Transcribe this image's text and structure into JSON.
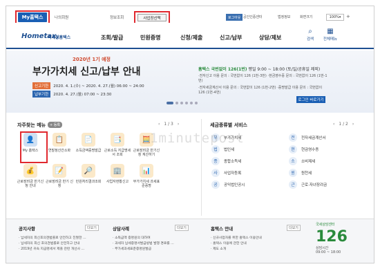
{
  "topbar": {
    "my_tab": "My홈택스",
    "my_info": "나의회원",
    "sep_text": "정보조회",
    "business_select": "사업장선택",
    "logout": "로그아웃",
    "cert_center": "공인인증센터",
    "basic_info": "법정정보",
    "screen_size": "화면크기",
    "zoom": "100%"
  },
  "nav": {
    "logo": "Hometax,",
    "logo_sub": "국세청홈택스",
    "items": [
      "조회/발급",
      "민원증명",
      "신청/제출",
      "신고/납부",
      "상담/제보"
    ],
    "search": "검색",
    "all_menu": "전체메뉴"
  },
  "banner": {
    "subtitle": "2020년 1기 예정",
    "title": "부가가치세 신고/납부 안내",
    "rows": [
      {
        "tag": "신고기한",
        "text": "2020. 4. 1.(수) ~ 2020. 4. 27.(월) 06:00 ~ 24:00"
      },
      {
        "tag": "납부기한",
        "text": "2020. 4. 27.(월) 07:00 ~ 23:30"
      }
    ],
    "right_head": "홈택스 국번없이 126(1번)",
    "right_hours": "평일 9:00 ~ 18:00 (토/일/공휴일 제외)",
    "right_lines": [
      "·전자신고 이용 문의 : 국번없이 126 (1번-3번) ·현금영수증 문의 : 국번없이 126 (1번-1번)",
      "·전자세금계산서 이용 문의 : 국번없이 126 (1번-2번) ·증명발급 이용 문의 : 국번없이 126 (1번-4번)"
    ],
    "button": "로그인 바로가기"
  },
  "favorites": {
    "title": "자주찾는 메뉴",
    "add": "+ 등록",
    "page": "1 / 3",
    "items": [
      {
        "label": "My 홈택스",
        "icon": "user-icon",
        "glyph": "👤",
        "blue": true
      },
      {
        "label": "연말정산간소화",
        "icon": "document-icon",
        "glyph": "📋",
        "blue": false
      },
      {
        "label": "소득금액증명발급",
        "icon": "certificate-icon",
        "glyph": "📄",
        "blue": false
      },
      {
        "label": "근로소득 지급명세서 조회",
        "icon": "list-icon",
        "glyph": "📑",
        "blue": false
      },
      {
        "label": "근로장려금 반기신청 계산하기",
        "icon": "calculator-icon",
        "glyph": "🧮",
        "blue": false
      },
      {
        "label": "",
        "icon": "",
        "glyph": "",
        "blue": false
      },
      {
        "label": "근로장려금 반기신청 안내",
        "icon": "money-icon",
        "glyph": "💰",
        "blue": false
      },
      {
        "label": "근로장려금 반기 신청",
        "icon": "apply-icon",
        "glyph": "📝",
        "blue": false
      },
      {
        "label": "민원처리결과조회",
        "icon": "search-doc-icon",
        "glyph": "🔎",
        "blue": false
      },
      {
        "label": "사업자현황신고",
        "icon": "building-icon",
        "glyph": "🏢",
        "blue": false
      },
      {
        "label": "부가가치세 과세표준증명",
        "icon": "report-icon",
        "glyph": "📊",
        "blue": false
      },
      {
        "label": "",
        "icon": "",
        "glyph": "",
        "blue": false
      }
    ]
  },
  "tax_services": {
    "title": "세금종류별 서비스",
    "page": "1 / 2",
    "items": [
      {
        "label": "부가가치세",
        "icon": "vat-icon",
        "glyph": "부"
      },
      {
        "label": "전자세금계산서",
        "icon": "invoice-icon",
        "glyph": "전"
      },
      {
        "label": "법인세",
        "icon": "corp-tax-icon",
        "glyph": "법"
      },
      {
        "label": "현금영수증",
        "icon": "receipt-icon",
        "glyph": "현"
      },
      {
        "label": "종합소득세",
        "icon": "income-tax-icon",
        "glyph": "종"
      },
      {
        "label": "소비제세",
        "icon": "consumption-tax-icon",
        "glyph": "소"
      },
      {
        "label": "사업자등록",
        "icon": "registration-icon",
        "glyph": "사"
      },
      {
        "label": "원천세",
        "icon": "withholding-icon",
        "glyph": "원"
      },
      {
        "label": "공익법인공시",
        "icon": "public-corp-icon",
        "glyph": "공"
      },
      {
        "label": "근로·자녀장려금",
        "icon": "incentive-icon",
        "glyph": "근"
      }
    ]
  },
  "bottom": {
    "notice": {
      "title": "공지사항",
      "more": "더보기",
      "items": [
        "납세자의 최신호의견법률로 안전하고 친절한 ...",
        "납세자의 최신 호의견법률로 안전하고 안내",
        "2019년 귀속 지급명세서 제출 관련 개선사 ..."
      ]
    },
    "consult": {
      "title": "상담사례",
      "more": "더보기",
      "items": [
        "소득금액 증명원의 대하여",
        "과세자 납세증명서발급방법 발행 경로를 ...",
        "부가세과세표준증명원발급"
      ]
    },
    "hometax": {
      "title": "홈택스 안내",
      "more": "더보기",
      "items": [
        "신규사업자를 위한 홈택스 이용안내",
        "홈택스 이용에 관한 안내",
        "제도 소개"
      ]
    },
    "promo": {
      "top": "국세상담센터",
      "number": "126",
      "hours_label": "상담시간",
      "hours": "09:00 ~ 18:00"
    }
  },
  "watermark": "1minutepost"
}
